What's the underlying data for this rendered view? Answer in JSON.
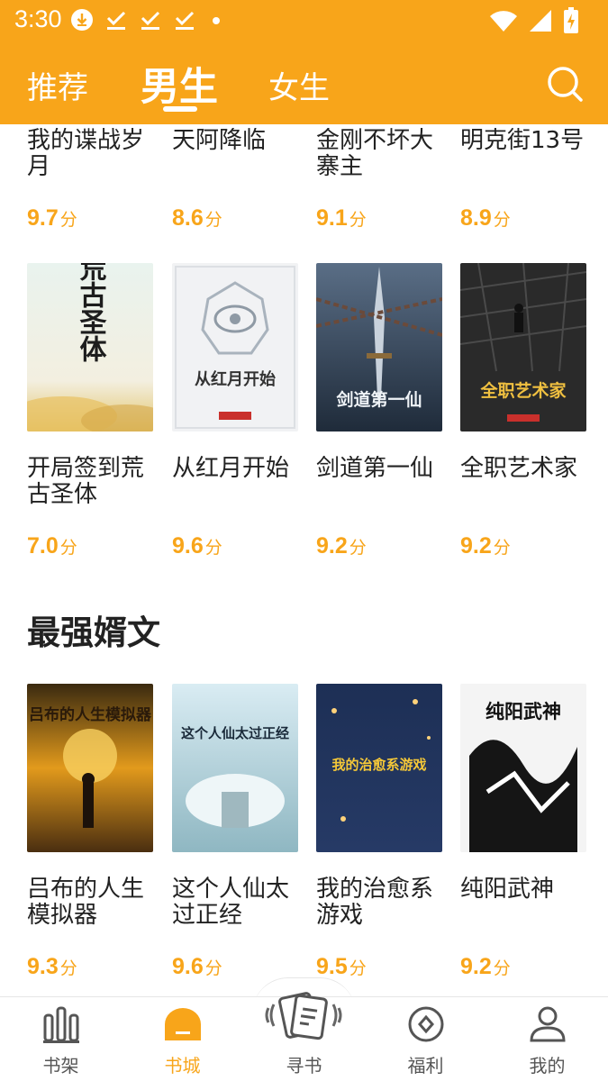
{
  "status_bar": {
    "time": "3:30"
  },
  "top_nav": {
    "tabs": [
      {
        "label": "推荐",
        "active": false
      },
      {
        "label": "男生",
        "active": true
      },
      {
        "label": "女生",
        "active": false
      }
    ],
    "accent_color": "#f8a51a"
  },
  "books_row0": [
    {
      "title": "我的谍战岁月",
      "score": "9.7",
      "unit": "分"
    },
    {
      "title": "天阿降临",
      "score": "8.6",
      "unit": "分"
    },
    {
      "title": "金刚不坏大寨主",
      "score": "9.1",
      "unit": "分"
    },
    {
      "title": "明克街13号",
      "score": "8.9",
      "unit": "分"
    }
  ],
  "books_row1": [
    {
      "title": "开局签到荒古圣体",
      "score": "7.0",
      "unit": "分",
      "cover_text": "荒古圣体"
    },
    {
      "title": "从红月开始",
      "score": "9.6",
      "unit": "分",
      "cover_text": "从红月开始"
    },
    {
      "title": "剑道第一仙",
      "score": "9.2",
      "unit": "分",
      "cover_text": "剑道第一仙"
    },
    {
      "title": "全职艺术家",
      "score": "9.2",
      "unit": "分",
      "cover_text": "全职艺术家"
    }
  ],
  "section": {
    "title": "最强婿文"
  },
  "books_row2": [
    {
      "title": "吕布的人生模拟器",
      "score": "9.3",
      "unit": "分",
      "cover_text": "吕布的人生模拟器"
    },
    {
      "title": "这个人仙太过正经",
      "score": "9.6",
      "unit": "分",
      "cover_text": "这个人仙太过正经"
    },
    {
      "title": "我的治愈系游戏",
      "score": "9.5",
      "unit": "分",
      "cover_text": "我的治愈系游戏"
    },
    {
      "title": "纯阳武神",
      "score": "9.2",
      "unit": "分",
      "cover_text": "纯阳武神"
    }
  ],
  "bottom_nav": [
    {
      "label": "书架",
      "icon": "bookshelf-icon",
      "active": false
    },
    {
      "label": "书城",
      "icon": "bookstore-icon",
      "active": true
    },
    {
      "label": "寻书",
      "icon": "find-book-icon",
      "active": false
    },
    {
      "label": "福利",
      "icon": "welfare-icon",
      "active": false
    },
    {
      "label": "我的",
      "icon": "profile-icon",
      "active": false
    }
  ]
}
